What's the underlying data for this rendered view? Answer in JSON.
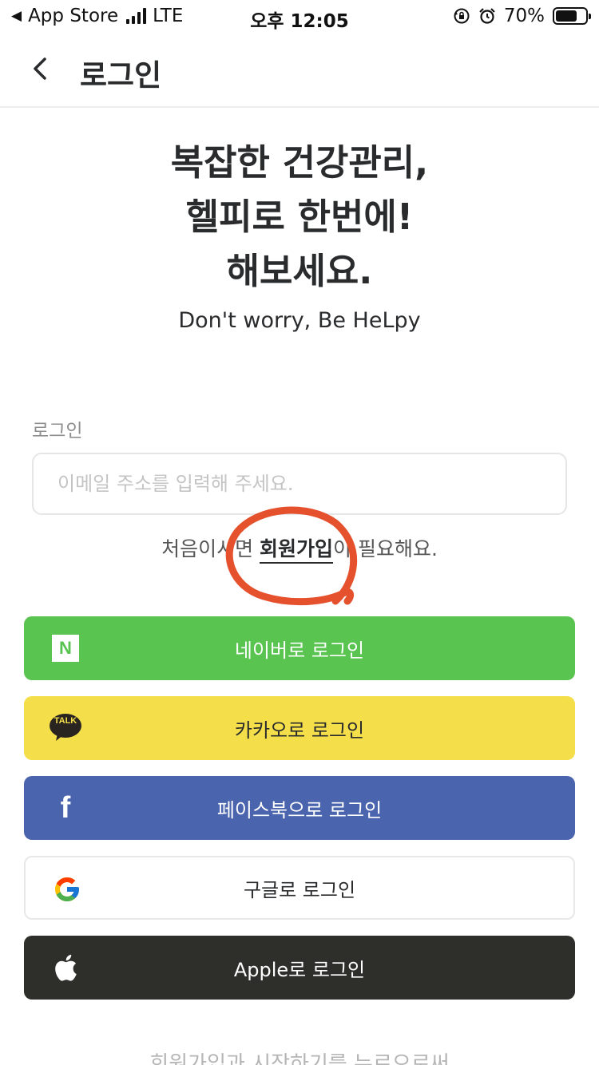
{
  "status_bar": {
    "carrier_back": "App Store",
    "network": "LTE",
    "time": "오후 12:05",
    "battery": "70%"
  },
  "nav": {
    "title": "로그인"
  },
  "hero": {
    "line1": "복잡한 건강관리,",
    "line2": "헬피로 한번에!",
    "line3": "해보세요.",
    "subtitle": "Don't worry, Be HeLpy"
  },
  "form": {
    "label": "로그인",
    "email_placeholder": "이메일 주소를 입력해 주세요.",
    "email_value": "",
    "signup_prefix": "처음이시면 ",
    "signup_link": "회원가입",
    "signup_suffix": "이 필요해요."
  },
  "social": {
    "naver": "네이버로 로그인",
    "kakao": "카카오로 로그인",
    "facebook": "페이스북으로 로그인",
    "google": "구글로 로그인",
    "apple": "Apple로 로그인",
    "kakao_icon_text": "TALK",
    "naver_icon_text": "N",
    "facebook_icon_text": "f"
  },
  "footer": {
    "text": "회원가입과 시작하기를 누르으로써"
  },
  "colors": {
    "naver": "#5ac451",
    "kakao": "#f4df4a",
    "facebook": "#4a64ae",
    "apple": "#2e2e2b",
    "annotation": "#e5502d"
  },
  "icons": [
    "back-chevron-icon",
    "signal-icon",
    "rotation-lock-icon",
    "alarm-icon",
    "battery-icon",
    "naver-icon",
    "kakao-talk-icon",
    "facebook-icon",
    "google-icon",
    "apple-icon"
  ]
}
